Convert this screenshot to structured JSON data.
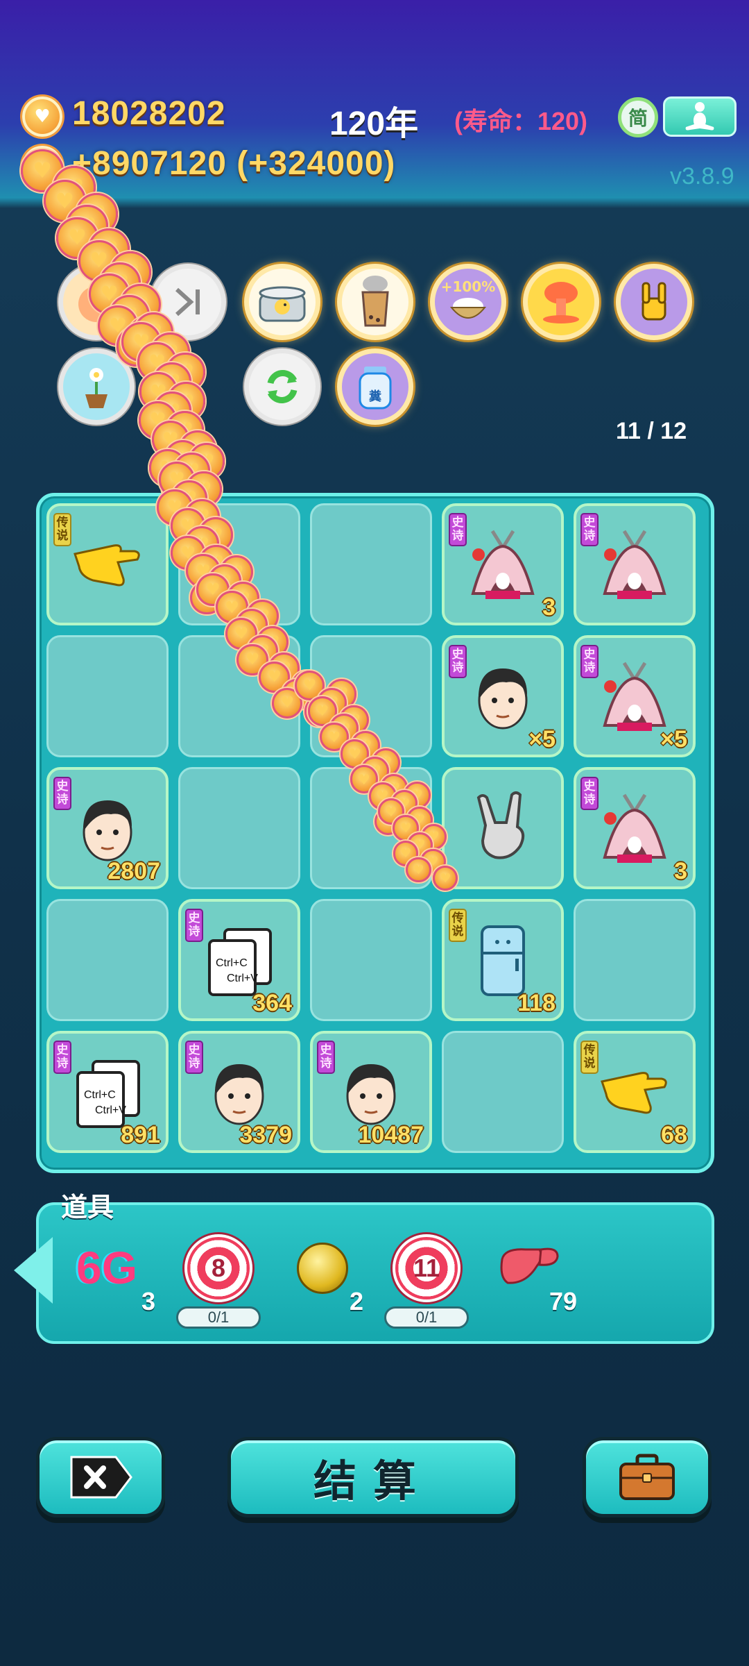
{
  "header": {
    "coins": "18028202",
    "income": "+8907120 (+324000)",
    "year": "120年",
    "lifespan": "(寿命：120)",
    "lang_label": "简",
    "version": "v3.8.9"
  },
  "buffs": {
    "percent_label": "+100%",
    "jar_label": "糞",
    "slots": "11 / 12"
  },
  "board": {
    "rows": [
      [
        {
          "tag": "传说",
          "rarity": "legend",
          "item": "pointing-hand-icon",
          "count": ""
        },
        {
          "tag": "",
          "rarity": "",
          "item": "",
          "count": ""
        },
        {
          "tag": "",
          "rarity": "",
          "item": "",
          "count": ""
        },
        {
          "tag": "史诗",
          "rarity": "epic",
          "item": "rabbit-tent-icon",
          "count": "3"
        },
        {
          "tag": "史诗",
          "rarity": "epic",
          "item": "rabbit-tent-icon",
          "count": ""
        }
      ],
      [
        {
          "tag": "",
          "rarity": "",
          "item": "",
          "count": ""
        },
        {
          "tag": "",
          "rarity": "",
          "item": "",
          "count": ""
        },
        {
          "tag": "",
          "rarity": "",
          "item": "",
          "count": ""
        },
        {
          "tag": "史诗",
          "rarity": "epic",
          "item": "face-icon",
          "count": "×5"
        },
        {
          "tag": "史诗",
          "rarity": "epic",
          "item": "rabbit-tent-icon",
          "count": "×5"
        }
      ],
      [
        {
          "tag": "史诗",
          "rarity": "epic",
          "item": "face-icon",
          "count": "2807"
        },
        {
          "tag": "",
          "rarity": "",
          "item": "",
          "count": ""
        },
        {
          "tag": "",
          "rarity": "",
          "item": "",
          "count": ""
        },
        {
          "tag": "",
          "rarity": "",
          "item": "rock-hand-icon",
          "count": ""
        },
        {
          "tag": "史诗",
          "rarity": "epic",
          "item": "rabbit-tent-icon",
          "count": "3"
        }
      ],
      [
        {
          "tag": "",
          "rarity": "",
          "item": "",
          "count": ""
        },
        {
          "tag": "史诗",
          "rarity": "epic",
          "item": "copy-paste-icon",
          "count": "364"
        },
        {
          "tag": "",
          "rarity": "",
          "item": "",
          "count": ""
        },
        {
          "tag": "传说",
          "rarity": "legend",
          "item": "fridge-icon",
          "count": "118"
        },
        {
          "tag": "",
          "rarity": "",
          "item": "",
          "count": ""
        }
      ],
      [
        {
          "tag": "史诗",
          "rarity": "epic",
          "item": "copy-paste-icon",
          "count": "891"
        },
        {
          "tag": "史诗",
          "rarity": "epic",
          "item": "face-icon",
          "count": "3379"
        },
        {
          "tag": "史诗",
          "rarity": "epic",
          "item": "face-icon",
          "count": "10487"
        },
        {
          "tag": "",
          "rarity": "",
          "item": "",
          "count": ""
        },
        {
          "tag": "传说",
          "rarity": "legend",
          "item": "pointing-hand-icon",
          "count": "68"
        }
      ]
    ],
    "copy_label": "Ctrl+C",
    "paste_label": "Ctrl+V"
  },
  "items_bar": {
    "title": "道具",
    "items": [
      {
        "name": "6G",
        "count": "3"
      },
      {
        "name": "8",
        "progress": "0/1"
      },
      {
        "name": "gold-ball-icon",
        "count": "2"
      },
      {
        "name": "11",
        "progress": "0/1"
      },
      {
        "name": "liver-icon",
        "count": "79"
      }
    ]
  },
  "buttons": {
    "settle": "结算"
  },
  "colors": {
    "board_bg": "#1fb3ba",
    "epic_tag": "#c24ad8",
    "legend_tag": "#e9d34a",
    "count_text": "#ffe066"
  }
}
